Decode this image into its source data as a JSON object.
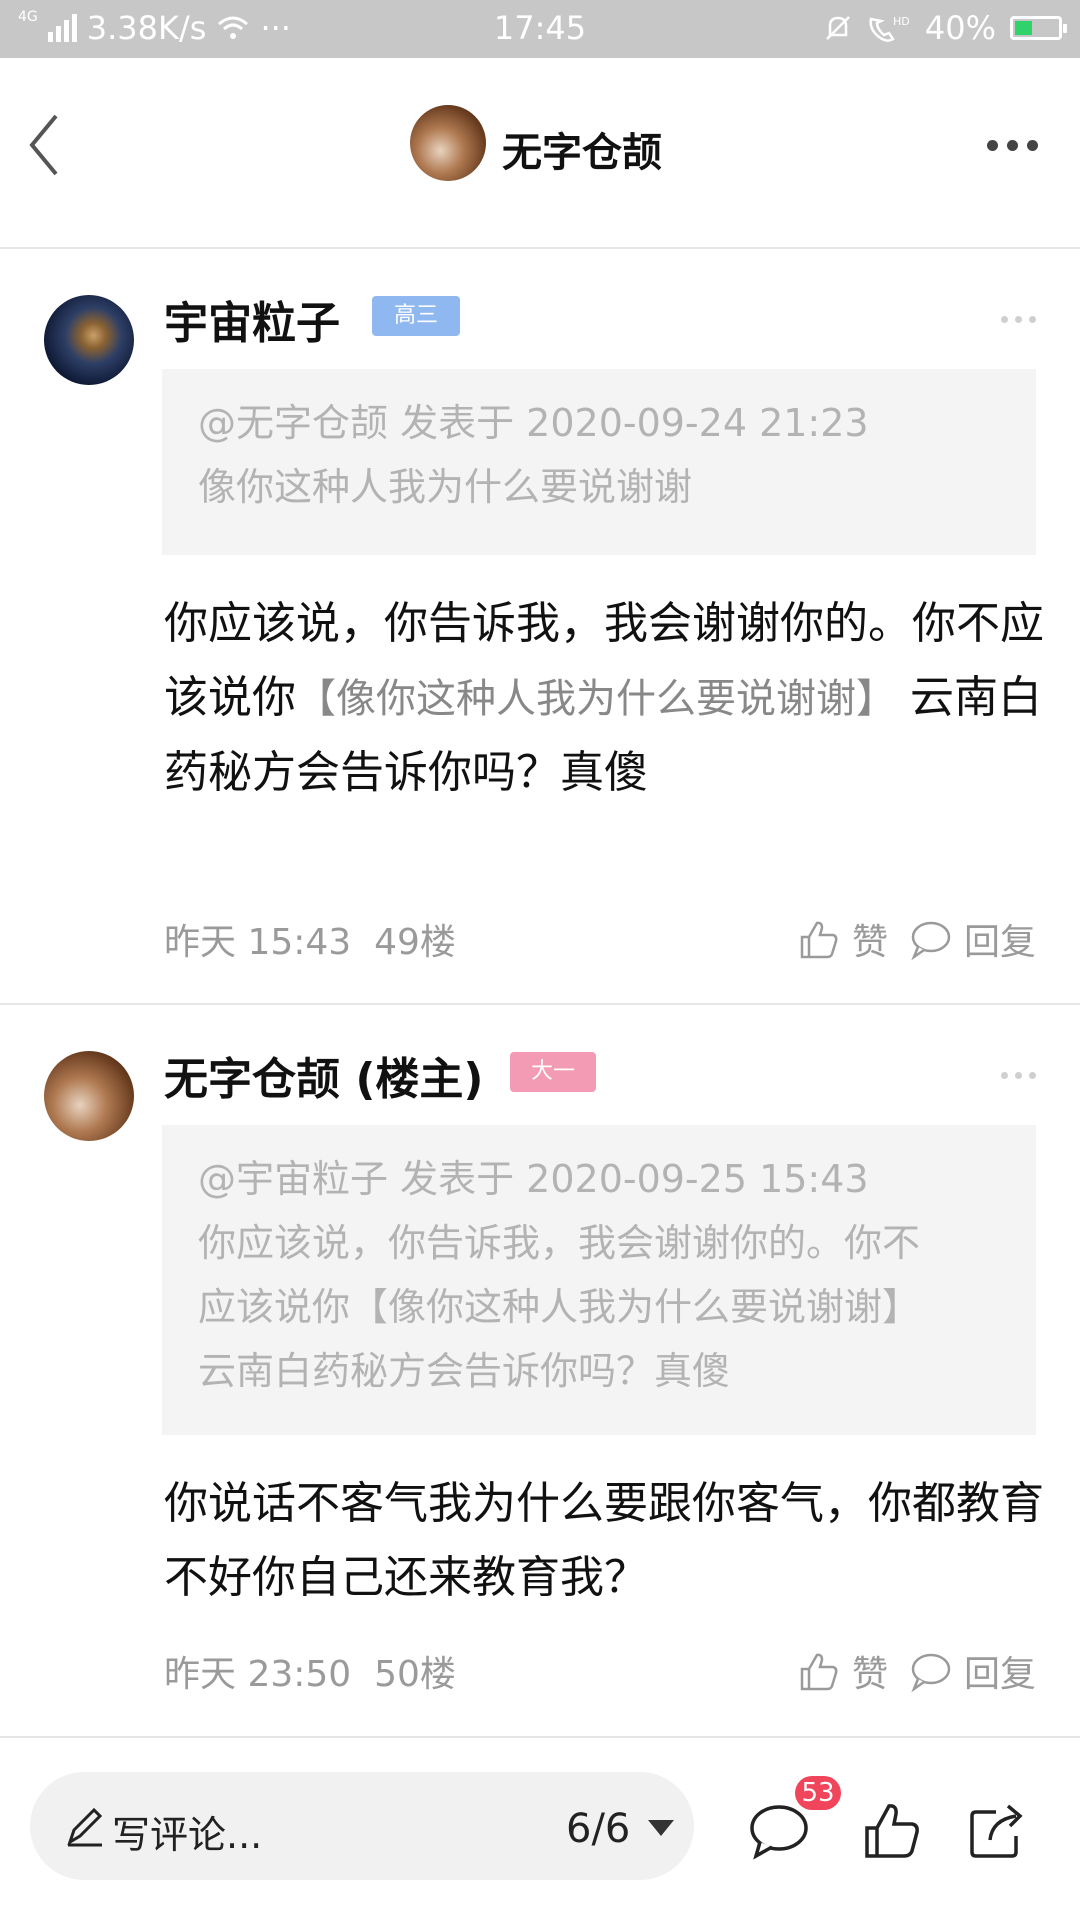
{
  "status_bar": {
    "network_type": "4G",
    "speed": "3.38K/s",
    "more": "···",
    "time": "17:45",
    "battery": "40%",
    "battery_level": 0.4
  },
  "header": {
    "title": "无字仓颉"
  },
  "comments": [
    {
      "username": "宇宙粒子",
      "badge": "高三",
      "badge_color": "#8fb8f0",
      "quote_meta": "@无字仓颉 发表于 2020-09-24 21:23",
      "quote_lines": [
        "像你这种人我为什么要说谢谢"
      ],
      "body_text": "你应该说，你告诉我，我会谢谢你的。你不应该说你",
      "body_quote": "【像你这种人我为什么要说谢谢】",
      "body_text_after": " 云南白药秘方会告诉你吗？真傻",
      "time": "昨天 15:43",
      "floor": "49楼",
      "like_label": "赞",
      "reply_label": "回复"
    },
    {
      "username": "无字仓颉 (楼主)",
      "badge": "大一",
      "badge_color": "#f39ab4",
      "quote_meta": "@宇宙粒子 发表于 2020-09-25 15:43",
      "quote_lines": [
        "你应该说，你告诉我，我会谢谢你的。你不",
        "应该说你【像你这种人我为什么要说谢谢】",
        "云南白药秘方会告诉你吗？真傻"
      ],
      "body_text": "你说话不客气我为什么要跟你客气，你都教育不好你自己还来教育我？",
      "time": "昨天 23:50",
      "floor": "50楼",
      "like_label": "赞",
      "reply_label": "回复"
    }
  ],
  "bottom_bar": {
    "input_placeholder": "写评论...",
    "page_indicator": "6/6",
    "comment_count": "53"
  }
}
